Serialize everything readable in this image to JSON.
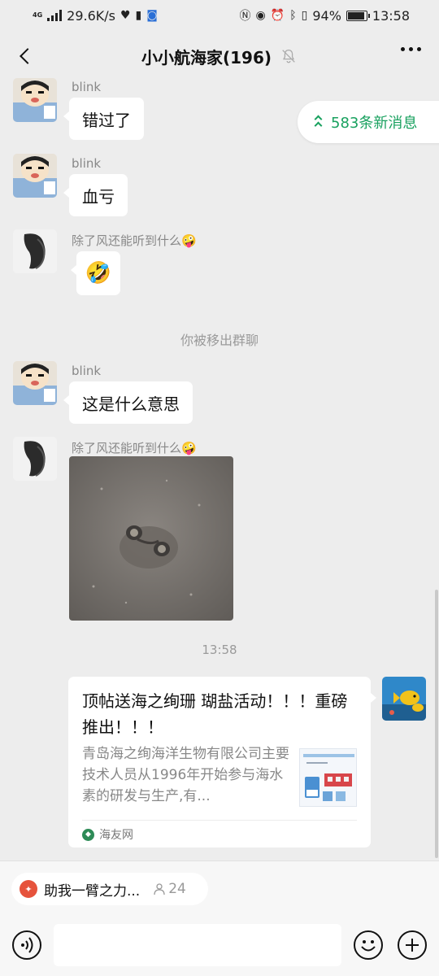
{
  "status_bar": {
    "network_type": "4G",
    "speed": "29.6K/s",
    "battery": "94%",
    "battery_level": 0.94,
    "time": "13:58"
  },
  "header": {
    "title": "小小航海家(196)",
    "back_icon": "back-arrow-icon",
    "mute_icon": "bell-muted-icon",
    "more_icon": "more-dots-icon"
  },
  "new_messages_pill": {
    "label": "583条新消息",
    "color": "#19a15f"
  },
  "messages": [
    {
      "sender": "blink",
      "text": "错过了"
    },
    {
      "sender": "blink",
      "text": "血亏"
    },
    {
      "sender": "除了风还能听到什么🤪",
      "emoji": "🤣"
    },
    {
      "system": "你被移出群聊"
    },
    {
      "sender": "blink",
      "text": "这是什么意思"
    },
    {
      "sender": "除了风还能听到什么🤪",
      "image": "sand-creature-photo"
    },
    {
      "timestamp": "13:58"
    }
  ],
  "link_card": {
    "title": "顶帖送海之绚珊 瑚盐活动！！！重磅推出！！！",
    "description": "青岛海之绚海洋生物有限公司主要技术人员从1996年开始参与海水素的研发与生产,有...",
    "source": "海友网"
  },
  "chip": {
    "label": "助我一臂之力...",
    "count": "24"
  },
  "input": {
    "placeholder": ""
  },
  "colors": {
    "background": "#ededed",
    "bubble": "#ffffff",
    "accent_green": "#19a15f"
  }
}
